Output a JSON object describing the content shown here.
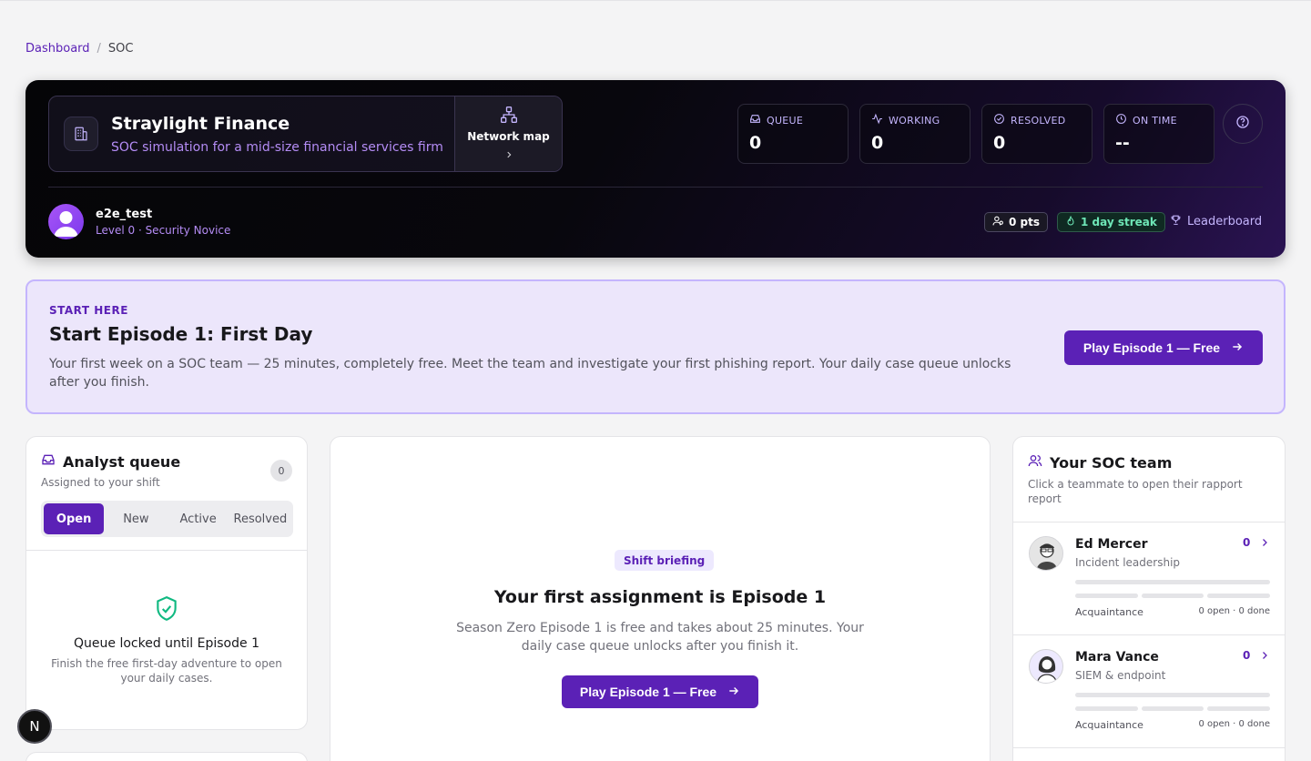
{
  "breadcrumb": {
    "home": "Dashboard",
    "separator": "/",
    "current": "SOC"
  },
  "hero": {
    "company_name": "Straylight Finance",
    "company_desc": "SOC simulation for a mid-size financial services firm",
    "network_map": "Network map",
    "stats": [
      {
        "label": "QUEUE",
        "value": "0",
        "icon": "inbox-icon"
      },
      {
        "label": "WORKING",
        "value": "0",
        "icon": "activity-icon"
      },
      {
        "label": "RESOLVED",
        "value": "0",
        "icon": "check-circle-icon"
      },
      {
        "label": "ON TIME",
        "value": "--",
        "icon": "clock-icon"
      }
    ],
    "user": {
      "name": "e2e_test",
      "level": "Level 0 · Security Novice"
    },
    "points": "0 pts",
    "streak": "1 day streak",
    "leaderboard": "Leaderboard"
  },
  "start_here": {
    "eyebrow": "START HERE",
    "title": "Start Episode 1: First Day",
    "description": "Your first week on a SOC team — 25 minutes, completely free. Meet the team and investigate your first phishing report. Your daily case queue unlocks after you finish.",
    "button": "Play Episode 1 — Free"
  },
  "analyst_queue": {
    "title": "Analyst queue",
    "subtitle": "Assigned to your shift",
    "count": "0",
    "tabs": [
      "Open",
      "New",
      "Active",
      "Resolved"
    ],
    "active_tab": "Open",
    "locked_title": "Queue locked until Episode 1",
    "locked_desc": "Finish the free first-day adventure to open your daily cases."
  },
  "briefing": {
    "badge": "Shift briefing",
    "title": "Your first assignment is Episode 1",
    "description": "Season Zero Episode 1 is free and takes about 25 minutes. Your daily case queue unlocks after you finish it.",
    "button": "Play Episode 1 — Free"
  },
  "team": {
    "title": "Your SOC team",
    "subtitle": "Click a teammate to open their rapport report",
    "members": [
      {
        "name": "Ed Mercer",
        "role": "Incident leadership",
        "score": "0",
        "stage": "Acquaintance",
        "counts": "0 open · 0 done"
      },
      {
        "name": "Mara Vance",
        "role": "SIEM & endpoint",
        "score": "0",
        "stage": "Acquaintance",
        "counts": "0 open · 0 done"
      }
    ]
  },
  "dev_badge": "N",
  "colors": {
    "accent": "#5b21b6",
    "success": "#10b981",
    "hero_bg": "#08070d"
  }
}
